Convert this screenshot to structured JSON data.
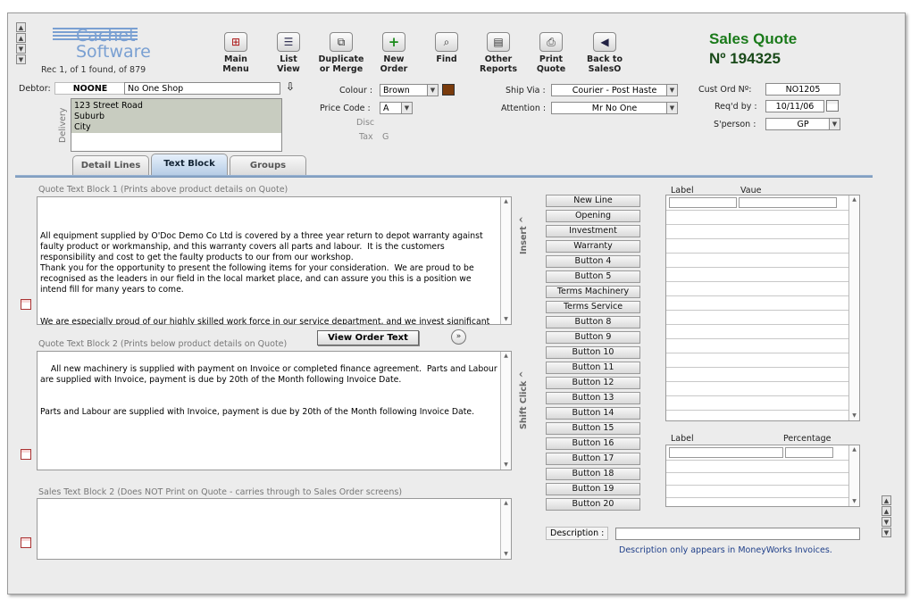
{
  "app": {
    "logo_line1": "Cachet",
    "logo_line2": "Software",
    "record_info": "Rec 1, of 1 found, of 879"
  },
  "toolbar": [
    {
      "name": "main-menu",
      "line1": "Main",
      "line2": "Menu",
      "icon": "sitemap-icon",
      "glyph": "⊞"
    },
    {
      "name": "list-view",
      "line1": "List",
      "line2": "View",
      "icon": "list-icon",
      "glyph": "☰"
    },
    {
      "name": "duplicate-merge",
      "line1": "Duplicate",
      "line2": "or Merge",
      "icon": "duplicate-icon",
      "glyph": "⧉"
    },
    {
      "name": "new-order",
      "line1": "New",
      "line2": "Order",
      "icon": "plus-icon",
      "glyph": "+"
    },
    {
      "name": "find",
      "line1": "Find",
      "line2": "",
      "icon": "magnifier-icon",
      "glyph": "⌕"
    },
    {
      "name": "other-reports",
      "line1": "Other",
      "line2": "Reports",
      "icon": "report-icon",
      "glyph": "▤"
    },
    {
      "name": "print-quote",
      "line1": "Print",
      "line2": "Quote",
      "icon": "printer-icon",
      "glyph": "⎙"
    },
    {
      "name": "back-to-saleso",
      "line1": "Back to",
      "line2": "SalesO",
      "icon": "back-arrow-icon",
      "glyph": "◀"
    }
  ],
  "header": {
    "title": "Sales Quote",
    "number": "Nº 194325"
  },
  "debtor": {
    "label": "Debtor:",
    "code": "NOONE",
    "name": "No One Shop"
  },
  "delivery": {
    "label": "Delivery",
    "lines": "123 Street Road\nSuburb\nCity"
  },
  "fields": {
    "colour_label": "Colour :",
    "colour_value": "Brown",
    "colour_swatch": "#7a3b0c",
    "price_code_label": "Price Code :",
    "price_code_value": "A",
    "disc_label": "Disc",
    "tax_label": "Tax",
    "tax_value": "G",
    "ship_via_label": "Ship Via :",
    "ship_via_value": "Courier - Post Haste",
    "attention_label": "Attention :",
    "attention_value": "Mr No One",
    "cust_ord_label": "Cust Ord Nº:",
    "cust_ord_value": "NO1205",
    "reqd_by_label": "Req'd by :",
    "reqd_by_value": "10/11/06",
    "sperson_label": "S'person :",
    "sperson_value": "GP"
  },
  "tabs": [
    {
      "label": "Detail Lines"
    },
    {
      "label": "Text Block"
    },
    {
      "label": "Groups"
    }
  ],
  "blocks": {
    "block1_label": "Quote Text Block 1 (Prints above product details on Quote)",
    "block1_text": "All equipment supplied by O'Doc Demo Co Ltd is covered by a three year return to depot warranty against faulty product or workmanship, and this warranty covers all parts and labour.  It is the customers responsibility and cost to get the faulty products to our from our workshop.\nThank you for the opportunity to present the following items for your consideration.  We are proud to be recognised as the leaders in our field in the local market place, and can assure you this is a position we intend fill for many years to come.\n\n\nWe are especially proud of our highly skilled work force in our service department, and we invest significant sums annually ensuring they all maintain the highest possible levels of expertise in their areas of responsibility.",
    "block2_label": "Quote Text Block 2 (Prints below product details on Quote)",
    "block2_text": "All new machinery is supplied with payment on Invoice or completed finance agreement.  Parts and Labour are supplied with Invoice, payment is due by 20th of the Month following Invoice Date.\n\n\nParts and Labour are supplied with Invoice, payment is due by 20th of the Month following Invoice Date.",
    "block3_label": "Sales Text Block 2 (Does NOT Print on Quote - carries through to Sales Order screens)",
    "block3_text": "",
    "view_order_text": "View Order Text",
    "insert_label": "Insert",
    "insert_arrow": "^",
    "shift_click_label": "Shift Click",
    "shift_click_arrow": "^"
  },
  "insert_buttons": [
    "New Line",
    "Opening",
    "Investment",
    "Warranty",
    "Button 4",
    "Button 5",
    "Terms Machinery",
    "Terms Service",
    "Button 8",
    "Button 9",
    "Button 10",
    "Button 11",
    "Button 12",
    "Button 13",
    "Button 14",
    "Button 15",
    "Button 16",
    "Button 17",
    "Button 18",
    "Button 19",
    "Button 20"
  ],
  "grid1": {
    "label_header": "Label",
    "value_header": "Vaue"
  },
  "grid2": {
    "label_header": "Label",
    "percentage_header": "Percentage"
  },
  "description": {
    "label": "Description :",
    "value": "",
    "note": "Description only appears in MoneyWorks Invoices."
  }
}
